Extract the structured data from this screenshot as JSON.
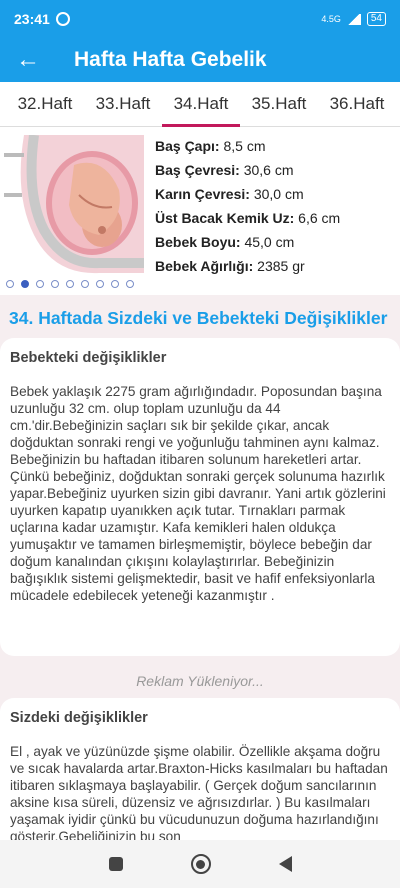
{
  "status": {
    "time": "23:41",
    "network": "4.5G",
    "battery": "54"
  },
  "appbar": {
    "title": "Hafta Hafta Gebelik"
  },
  "tabs": [
    "32.Haft",
    "33.Haft",
    "34.Haft",
    "35.Haft",
    "36.Haft"
  ],
  "active_tab": 2,
  "stats": [
    {
      "label": "Baş Çapı:",
      "value": "8,5 cm"
    },
    {
      "label": "Baş Çevresi:",
      "value": "30,6 cm"
    },
    {
      "label": "Karın Çevresi:",
      "value": "30,0 cm"
    },
    {
      "label": "Üst Bacak Kemik Uz:",
      "value": "6,6 cm"
    },
    {
      "label": "Bebek Boyu:",
      "value": "45,0 cm"
    },
    {
      "label": "Bebek Ağırlığı:",
      "value": "2385 gr"
    }
  ],
  "pager": {
    "count": 9,
    "active": 1
  },
  "heading": "34. Haftada Sizdeki ve Bebekteki Değişiklikler",
  "baby_card": {
    "title": "Bebekteki değişiklikler",
    "text": "Bebek yaklaşık 2275 gram ağırlığındadır. Poposundan başına uzunluğu 32 cm. olup toplam uzunluğu da 44 cm.'dir.Bebeğinizin saçları sık bir şekilde çıkar, ancak doğduktan sonraki rengi ve yoğunluğu tahminen aynı kalmaz. Bebeğinizin bu haftadan itibaren solunum hareketleri artar. Çünkü bebeğiniz, doğduktan sonraki gerçek solunuma hazırlık yapar.Bebeğiniz uyurken sizin gibi davranır. Yani artık gözlerini uyurken kapatıp uyanıkken açık tutar. Tırnakları parmak uçlarına kadar uzamıştır. Kafa kemikleri halen oldukça yumuşaktır ve tamamen birleşmemiştir, böylece bebeğin dar doğum kanalından çıkışını kolaylaştırırlar. Bebeğinizin bağışıklık sistemi gelişmektedir, basit ve hafif enfeksiyonlarla mücadele edebilecek yeteneği kazanmıştır ."
  },
  "ad": "Reklam Yükleniyor...",
  "mother_card": {
    "title": "Sizdeki değişiklikler",
    "text": "El , ayak ve yüzünüzde şişme olabilir. Özellikle akşama doğru ve sıcak havalarda artar.Braxton-Hicks kasılmaları bu haftadan itibaren sıklaşmaya başlayabilir. ( Gerçek doğum sancılarının aksine kısa süreli, düzensiz ve ağrısızdırlar. ) Bu kasılmaları yaşamak iyidir çünkü bu vücudunuzun doğuma hazırlandığını gösterir.Gebeliğinizin bu son"
  }
}
